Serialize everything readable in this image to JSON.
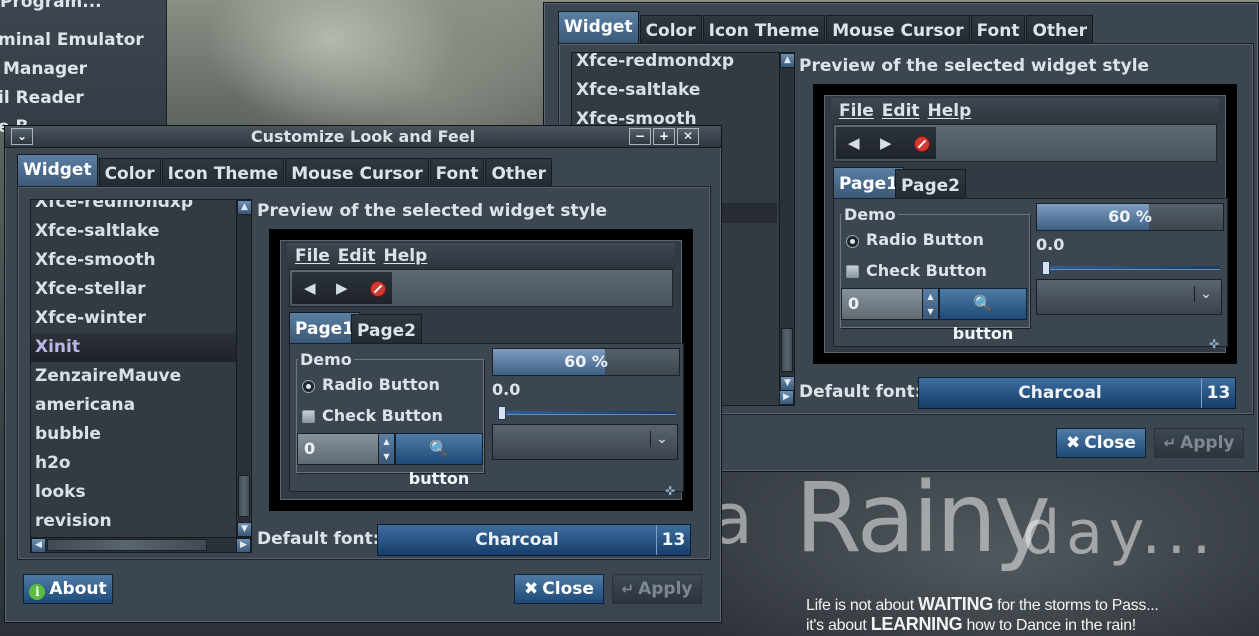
{
  "desktop": {
    "menu_items": [
      "Program...",
      "minal Emulator",
      "Manager",
      "il Reader",
      "e B..."
    ],
    "wallpaper_text_1": "a",
    "wallpaper_text_2": "Rainy",
    "wallpaper_text_3": "day...",
    "quote_line_1": {
      "a": "Life is not about ",
      "b": "WAITING",
      "c": " for the storms to Pass..."
    },
    "quote_line_2": {
      "a": "it's about ",
      "b": "LEARNING",
      "c": " how to Dance in the rain!"
    }
  },
  "back_window": {
    "tabs": [
      "Widget",
      "Color",
      "Icon Theme",
      "Mouse Cursor",
      "Font",
      "Other"
    ],
    "list_items": [
      "Xfce-redmondxp",
      "Xfce-saltlake",
      "Xfce-smooth"
    ],
    "preview_label": "Preview of the selected widget style",
    "default_font_label": "Default font:",
    "font_name": "Charcoal",
    "font_size": "13",
    "close_label": "Close",
    "apply_label": "Apply"
  },
  "front_window": {
    "title": "Customize Look and Feel",
    "tabs": [
      "Widget",
      "Color",
      "Icon Theme",
      "Mouse Cursor",
      "Font",
      "Other"
    ],
    "list_items": [
      "Xfce-redmondxp",
      "Xfce-saltlake",
      "Xfce-smooth",
      "Xfce-stellar",
      "Xfce-winter",
      "Xinit",
      "ZenzaireMauve",
      "americana",
      "bubble",
      "h2o",
      "looks",
      "revision"
    ],
    "selected_item": "Xinit",
    "preview_label": "Preview of the selected widget style",
    "default_font_label": "Default font:",
    "font_name": "Charcoal",
    "font_size": "13",
    "about_label": "About",
    "close_label": "Close",
    "apply_label": "Apply"
  },
  "preview": {
    "menus": [
      "File",
      "Edit",
      "Help"
    ],
    "tabs": [
      "Page1",
      "Page2"
    ],
    "frame_title": "Demo",
    "radio_label": "Radio Button",
    "check_label": "Check Button",
    "spin_value": "0",
    "search_button": "button",
    "progress_text": "60 %",
    "progress_value": 0.6,
    "slider_value_text": "0.0",
    "slider_value": 0
  },
  "colors": {
    "accent": "#3c5877",
    "selected_text": "#b9b7e6",
    "window_bg": "#3c4650"
  }
}
